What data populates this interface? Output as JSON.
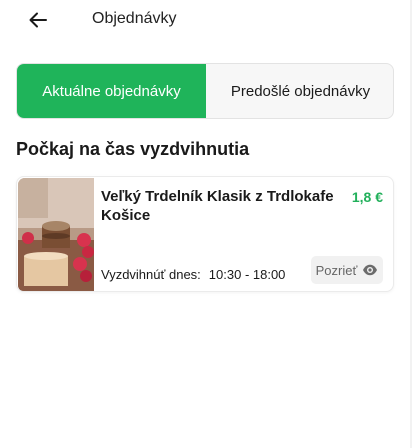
{
  "header": {
    "title": "Objednávky",
    "back_icon": "arrow-left-icon"
  },
  "tabs": [
    {
      "label": "Aktuálne objednávky",
      "active": true
    },
    {
      "label": "Predošlé objednávky",
      "active": false
    }
  ],
  "section": {
    "title": "Počkaj na čas vyzdvihnutia"
  },
  "orders": [
    {
      "name": "Veľký Trdelník Klasik z Trdlokafe Košice",
      "price": "1,8 €",
      "pickup_label": "Vyzdvihnúť dnes:",
      "pickup_time": "10:30 - 18:00",
      "view_label": "Pozrieť",
      "view_icon": "eye-icon"
    }
  ],
  "colors": {
    "accent": "#1fb45a",
    "price": "#22b05b"
  }
}
